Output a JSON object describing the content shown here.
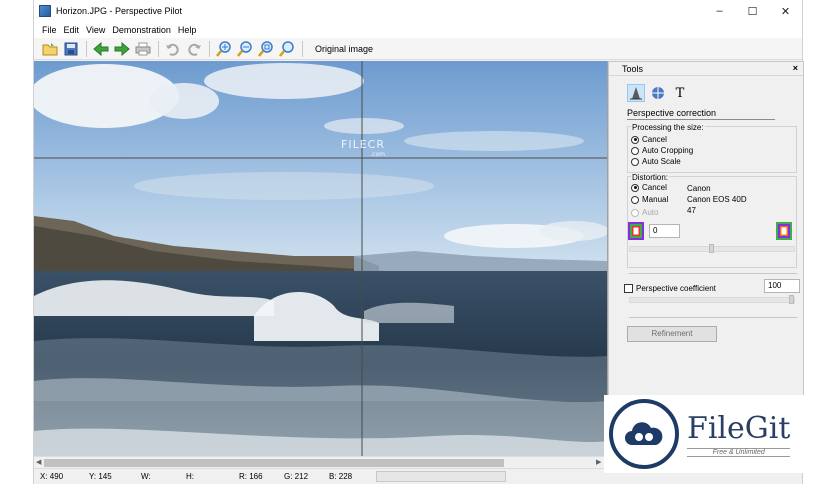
{
  "window": {
    "title": "Horizon.JPG - Perspective Pilot",
    "controls": {
      "minimize": "–",
      "maximize": "☐",
      "close": "✕"
    }
  },
  "menu": [
    "File",
    "Edit",
    "View",
    "Demonstration",
    "Help"
  ],
  "toolbar": {
    "original_image_label": "Original image"
  },
  "image": {
    "watermark_brand": "FILECR",
    "watermark_sub": ".com"
  },
  "status": {
    "x": "X: 490",
    "y": "Y: 145",
    "w": "W:",
    "h": "H:",
    "r": "R: 166",
    "g": "G: 212",
    "b": "B: 228"
  },
  "tools": {
    "header": "Tools",
    "close": "×",
    "tab_text_icon": "T",
    "section_title": "Perspective correction",
    "processing": {
      "label": "Processing the size:",
      "options": [
        "Cancel",
        "Auto Cropping",
        "Auto Scale"
      ],
      "selected": 0
    },
    "distortion": {
      "label": "Distortion:",
      "options": [
        "Cancel",
        "Manual",
        "Auto"
      ],
      "selected": 0,
      "camera_make": "Canon",
      "camera_model": "Canon EOS 40D",
      "focal": "47",
      "value": "0",
      "slider_level": 0.5
    },
    "perspective_coefficient": {
      "label": "Perspective coefficient",
      "value": "100",
      "checked": false
    },
    "refinement_button": "Refinement"
  },
  "filegit": {
    "name": "FileGit",
    "tagline": "Free & Unlimited"
  },
  "colors": {
    "sky_top": "#7fa9d6",
    "sea": "#2c3e50",
    "grid_line": "#555555",
    "brand": "#2a3f63"
  }
}
